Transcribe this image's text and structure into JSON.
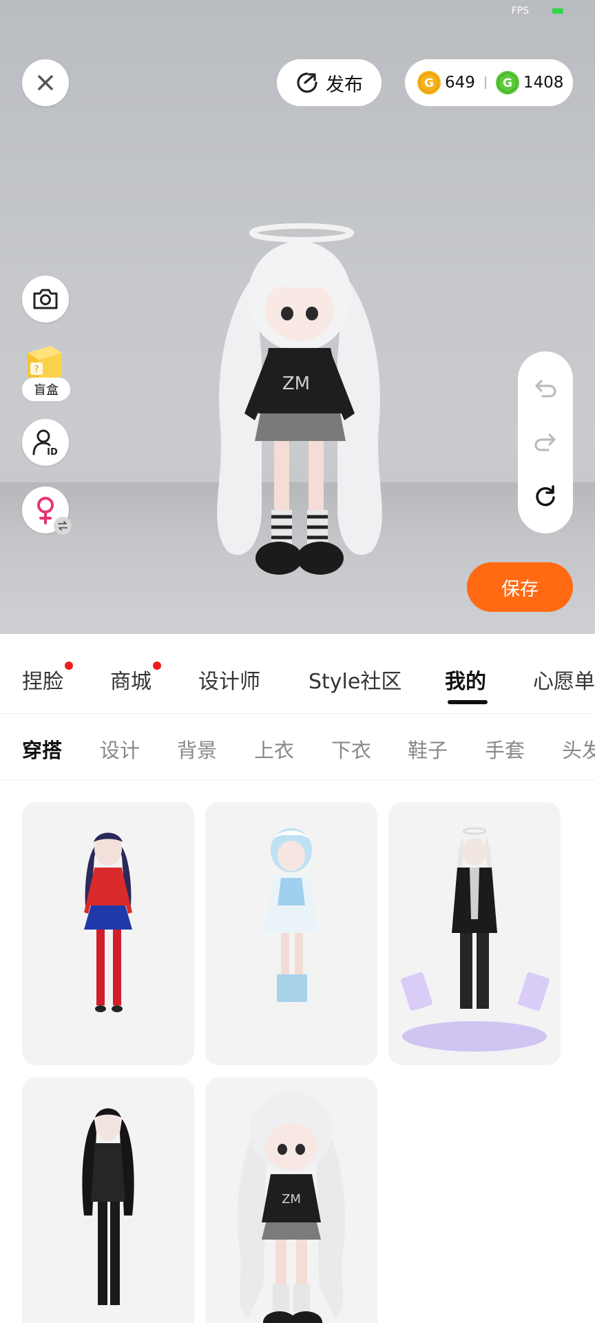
{
  "status_bar": {
    "fps_label": "FPS"
  },
  "header": {
    "publish_label": "发布",
    "coins_gold": "649",
    "coins_green": "1408",
    "gold_coin_glyph": "G",
    "green_coin_glyph": "G"
  },
  "side_tools": {
    "blind_box_label": "盲盒"
  },
  "save_label": "保存",
  "main_tabs": [
    {
      "label": "捏脸",
      "dot": true
    },
    {
      "label": "商城",
      "dot": true
    },
    {
      "label": "设计师",
      "dot": false
    },
    {
      "label": "Style社区",
      "dot": false
    },
    {
      "label": "我的",
      "dot": false,
      "active": true
    },
    {
      "label": "心愿单",
      "dot": false
    }
  ],
  "sub_tabs": [
    {
      "label": "穿搭",
      "active": true
    },
    {
      "label": "设计"
    },
    {
      "label": "背景"
    },
    {
      "label": "上衣"
    },
    {
      "label": "下衣"
    },
    {
      "label": "鞋子"
    },
    {
      "label": "手套"
    },
    {
      "label": "头发"
    }
  ],
  "outfits": [
    {
      "name": "red-sweater-blue-skirt-outfit"
    },
    {
      "name": "light-blue-maid-outfit"
    },
    {
      "name": "bunny-ears-black-jacket-outfit"
    },
    {
      "name": "black-long-hair-gothic-outfit"
    },
    {
      "name": "white-twin-tail-halo-outfit"
    }
  ],
  "colors": {
    "accent": "#ff6a13",
    "notification_dot": "#f01d1d",
    "gold_coin": "#f6b21a",
    "green_coin": "#5ac93a"
  }
}
